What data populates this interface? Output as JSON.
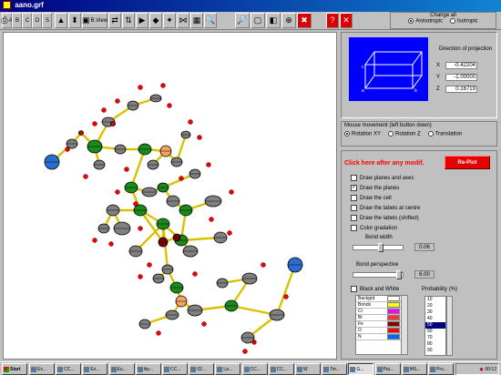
{
  "window": {
    "title": "aano.grf"
  },
  "toolbar": {
    "buttons": [
      {
        "name": "label-a-button",
        "label": "A",
        "glyph": "⎙"
      },
      {
        "name": "label-b-button",
        "label": "B",
        "glyph": ""
      },
      {
        "name": "label-c-button",
        "label": "C",
        "glyph": ""
      },
      {
        "name": "label-d-button",
        "label": "D",
        "glyph": ""
      },
      {
        "name": "label-s-button",
        "label": "S",
        "glyph": ""
      },
      {
        "name": "atoms-button",
        "label": "",
        "glyph": "▲"
      },
      {
        "name": "move-button",
        "label": "",
        "glyph": "⬍"
      },
      {
        "name": "bview-button",
        "label": "B.View",
        "glyph": "▣"
      },
      {
        "name": "rotate-x-button",
        "label": "",
        "glyph": "⇄"
      },
      {
        "name": "rotate-y-button",
        "label": "",
        "glyph": "⇅"
      },
      {
        "name": "tool-button-11",
        "label": "",
        "glyph": "▶"
      },
      {
        "name": "tool-button-12",
        "label": "",
        "glyph": "◆"
      },
      {
        "name": "tool-button-13",
        "label": "",
        "glyph": "✦"
      },
      {
        "name": "tool-button-14",
        "label": "",
        "glyph": "⋈"
      },
      {
        "name": "tool-button-15",
        "label": "",
        "glyph": "▦"
      },
      {
        "name": "zoom-in-button",
        "label": "",
        "glyph": "🔍"
      },
      {
        "name": "zoom-out-button",
        "label": "",
        "glyph": "🔎"
      },
      {
        "name": "fit-button",
        "label": "",
        "glyph": "▢"
      },
      {
        "name": "view-button",
        "label": "",
        "glyph": "◧"
      },
      {
        "name": "center-button",
        "label": "",
        "glyph": "⊕"
      },
      {
        "name": "stop-button",
        "label": "",
        "glyph": "✖"
      },
      {
        "name": "help-button",
        "label": "",
        "glyph": "?"
      },
      {
        "name": "close-button",
        "label": "",
        "glyph": "✕"
      }
    ],
    "change_all": {
      "title": "Change all",
      "options": [
        "Anisotropic",
        "Isotropic"
      ],
      "selected": "Anisotropic"
    }
  },
  "projection": {
    "label": "Direction of projection",
    "X": "-0.42204",
    "Y": "-1.00000",
    "Z": "0.16719"
  },
  "mouse_movement": {
    "title": "Mouse movement (left button down)",
    "options": [
      "Rotation XY",
      "Rotation Z",
      "Translation"
    ],
    "selected": "Rotation XY"
  },
  "options": {
    "hint": "Click here after any modif.",
    "replot_label": "Re-Plot",
    "checkboxes": [
      {
        "label": "Draw planes and axes",
        "checked": false
      },
      {
        "label": "Draw the planes",
        "checked": true
      },
      {
        "label": "Draw the cell",
        "checked": false
      },
      {
        "label": "Draw the labels at centre",
        "checked": false
      },
      {
        "label": "Draw the labels (shifted)",
        "checked": false
      },
      {
        "label": "Color gradation",
        "checked": false
      }
    ],
    "bond_width_label": "Bond width",
    "bond_width_value": "0.06",
    "bond_perspective_label": "Bond perspective",
    "bond_perspective_value": "6.00",
    "black_and_white_label": "Black and White",
    "black_and_white_checked": false,
    "probability_label": "Probability (%)"
  },
  "atom_colors": [
    {
      "name": "Backgrd",
      "color": "#ffffff"
    },
    {
      "name": "Bonds",
      "color": "#ffff00"
    },
    {
      "name": "Cl",
      "color": "#ff00ff"
    },
    {
      "name": "Br",
      "color": "#ff3333"
    },
    {
      "name": "Fe",
      "color": "#800000"
    },
    {
      "name": "O",
      "color": "#ff0000"
    },
    {
      "name": "N",
      "color": "#0066ff"
    }
  ],
  "probabilities": [
    "10",
    "20",
    "30",
    "40",
    "50",
    "60",
    "70",
    "80",
    "90"
  ],
  "probability_selected": "50",
  "taskbar": {
    "start": "Start",
    "tasks": [
      "Ex...",
      "CC...",
      "Ex...",
      "Eu...",
      "Ap...",
      "CC...",
      "02...",
      "La...",
      "CC...",
      "CC...",
      "W",
      "Ter...",
      "G...",
      "Pai...",
      "MS...",
      "Pro..."
    ],
    "active_index": 12,
    "clock": "00:12"
  }
}
